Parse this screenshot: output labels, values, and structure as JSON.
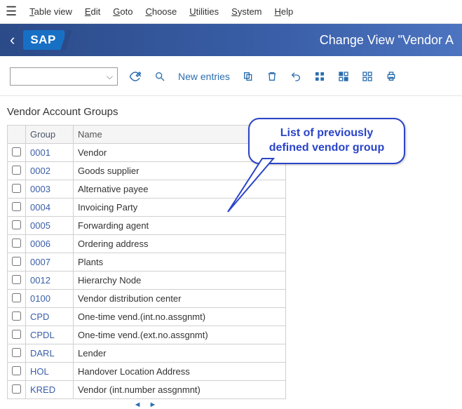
{
  "menubar": {
    "items": [
      {
        "pre": "T",
        "post": "able view"
      },
      {
        "pre": "E",
        "post": "dit"
      },
      {
        "pre": "G",
        "post": "oto"
      },
      {
        "pre": "C",
        "post": "hoose"
      },
      {
        "pre": "U",
        "post": "tilities"
      },
      {
        "pre": "S",
        "post": "ystem"
      },
      {
        "pre": "H",
        "post": "elp"
      }
    ]
  },
  "titlebar": {
    "logo": "SAP",
    "title": "Change View \"Vendor A"
  },
  "toolbar": {
    "combo_value": "",
    "new_entries_label": "New entries"
  },
  "section_title": "Vendor Account Groups",
  "grid": {
    "headers": {
      "group": "Group",
      "name": "Name"
    },
    "rows": [
      {
        "group": "0001",
        "name": "Vendor"
      },
      {
        "group": "0002",
        "name": "Goods supplier"
      },
      {
        "group": "0003",
        "name": "Alternative payee"
      },
      {
        "group": "0004",
        "name": "Invoicing Party"
      },
      {
        "group": "0005",
        "name": "Forwarding agent"
      },
      {
        "group": "0006",
        "name": "Ordering address"
      },
      {
        "group": "0007",
        "name": "Plants"
      },
      {
        "group": "0012",
        "name": "Hierarchy Node"
      },
      {
        "group": "0100",
        "name": "Vendor distribution center"
      },
      {
        "group": "CPD",
        "name": "One-time vend.(int.no.assgnmt)"
      },
      {
        "group": "CPDL",
        "name": "One-time vend.(ext.no.assgnmt)"
      },
      {
        "group": "DARL",
        "name": "Lender"
      },
      {
        "group": "HOL",
        "name": "Handover Location Address"
      },
      {
        "group": "KRED",
        "name": "Vendor (int.number assgnmnt)"
      }
    ]
  },
  "callout": {
    "line1": "List of previously",
    "line2": "defined vendor group"
  }
}
